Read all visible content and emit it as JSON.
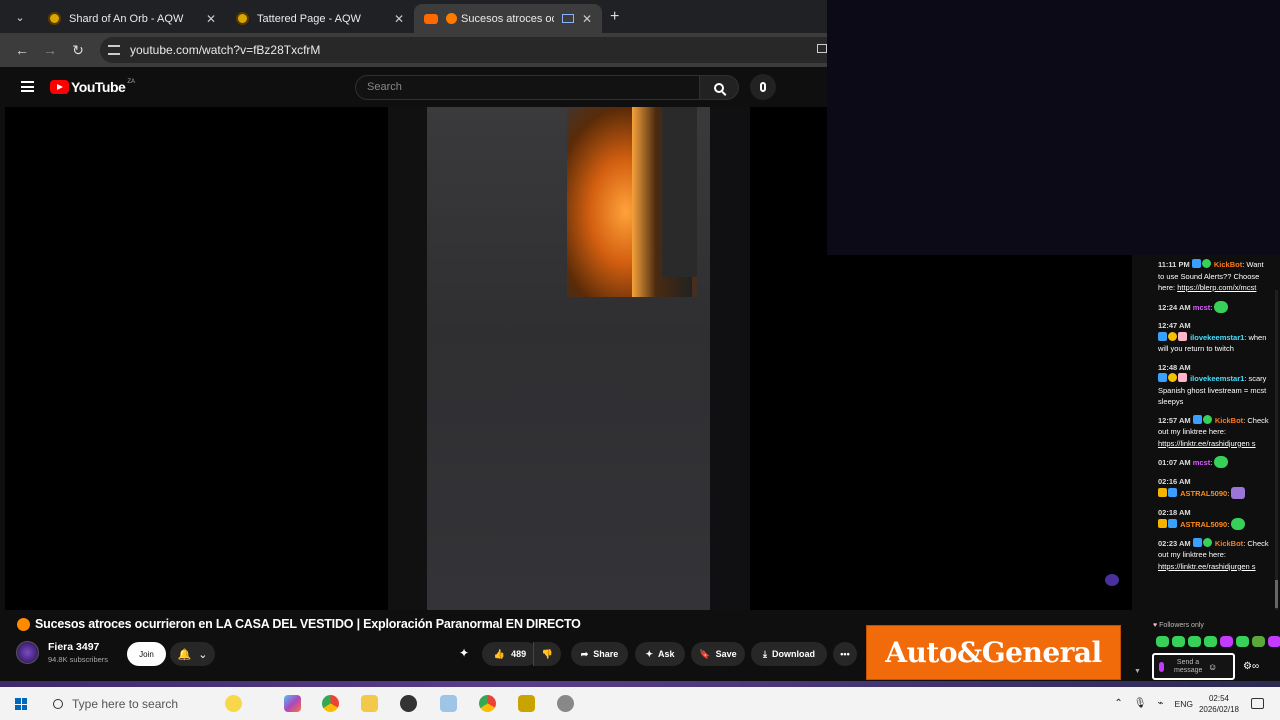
{
  "browser": {
    "tabs": [
      {
        "title": "Shard of An Orb - AQW",
        "active": false
      },
      {
        "title": "Tattered Page - AQW",
        "active": false
      },
      {
        "title": "Sucesos atroces ocurrie",
        "active": true
      }
    ],
    "url": "youtube.com/watch?v=fBz28TxcfrM"
  },
  "youtube": {
    "logo": "YouTube",
    "country": "ZA",
    "search_placeholder": "Search"
  },
  "video": {
    "title": "Sucesos atroces ocurrieron en LA CASA DEL VESTIDO | Exploración Paranormal EN DIRECTO",
    "channel": "Fiera 3497",
    "subscribers": "94.8K subscribers",
    "join_label": "Join",
    "likes": "489",
    "share_label": "Share",
    "ask_label": "Ask",
    "save_label": "Save",
    "download_label": "Download"
  },
  "ad": {
    "text": "Auto&General"
  },
  "chat": {
    "messages": [
      {
        "time": "11:11 PM",
        "user": "KickBot",
        "text": "Want to use Sound Alerts?? Choose here:",
        "link": "https://blerp.com/x/mcst"
      },
      {
        "time": "12:24 AM",
        "user": "mcst",
        "text": ""
      },
      {
        "time": "12:47 AM",
        "user": "ilovekeemstar1",
        "text": "when will you return to twitch"
      },
      {
        "time": "12:48 AM",
        "user": "ilovekeemstar1",
        "text": "scary Spanish ghost livestream = mcst sleepys"
      },
      {
        "time": "12:57 AM",
        "user": "KickBot",
        "text": "Check out my linktree here:",
        "link": "https://linktr.ee/rashidjurgen s"
      },
      {
        "time": "01:07 AM",
        "user": "mcst",
        "text": ""
      },
      {
        "time": "02:16 AM",
        "user": "ASTRAL5090",
        "text": ""
      },
      {
        "time": "02:18 AM",
        "user": "ASTRAL5090",
        "text": ""
      },
      {
        "time": "02:23 AM",
        "user": "KickBot",
        "text": "Check out my linktree here:",
        "link": "https://linktr.ee/rashidjurgen s"
      }
    ],
    "followers_only": "Followers only",
    "input_placeholder": "Send a message"
  },
  "taskbar": {
    "search_placeholder": "Type here to search",
    "language": "ENG",
    "time": "02:54",
    "date": "2026/02/18"
  }
}
